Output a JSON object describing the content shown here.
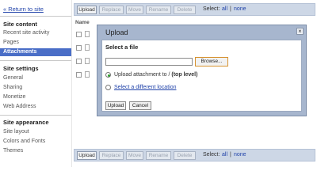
{
  "sidebar": {
    "return_link": "« Return to site",
    "sections": [
      {
        "title": "Site content",
        "items": [
          "Recent site activity",
          "Pages",
          "Attachments"
        ]
      },
      {
        "title": "Site settings",
        "items": [
          "General",
          "Sharing",
          "Monetize",
          "Web Address"
        ]
      },
      {
        "title": "Site appearance",
        "items": [
          "Site layout",
          "Colors and Fonts",
          "Themes"
        ]
      }
    ],
    "active_item": "Attachments"
  },
  "toolbar": {
    "upload": "Upload",
    "replace": "Replace",
    "move": "Move",
    "rename": "Rename",
    "delete": "Delete",
    "select_label": "Select:",
    "select_all": "all",
    "separator": "|",
    "select_none": "none"
  },
  "table": {
    "column_name": "Name"
  },
  "dialog": {
    "title": "Upload",
    "close": "×",
    "select_file_label": "Select a file",
    "browse_label": "Browse...",
    "radio_upload_prefix": "Upload attachment to / ",
    "radio_upload_bold": "(top level)",
    "radio_location": "Select a different location",
    "upload_button": "Upload",
    "cancel_button": "Cancel"
  }
}
